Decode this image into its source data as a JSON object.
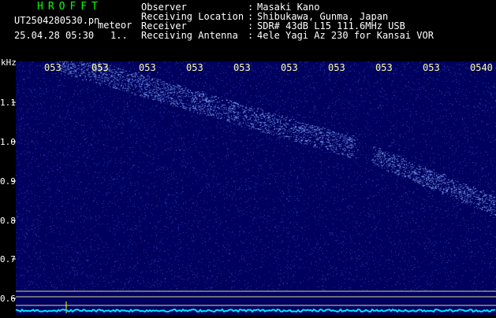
{
  "header": {
    "app_title": "HROFFT",
    "file_name": "UT2504280530.pn",
    "meteor_label": "meteor",
    "timestamp": "25.04.28 05:30",
    "count": "1.."
  },
  "info": [
    {
      "key": "Observer",
      "sep": ":",
      "value": "Masaki Kano"
    },
    {
      "key": "Receiving Location",
      "sep": ":",
      "value": "Shibukawa, Gunma, Japan"
    },
    {
      "key": "Receiver",
      "sep": ":",
      "value": "SDR# 43dB L15 111.6MHz USB"
    },
    {
      "key": "Receiving Antenna",
      "sep": ":",
      "value": "4ele Yagi Az 230 for Kansai VOR"
    }
  ],
  "plot": {
    "y_unit": "kHz",
    "y_ticks": [
      "1.1",
      "1.0",
      "0.9",
      "0.8",
      "0.7",
      "0.6"
    ],
    "x_ticks": [
      "053",
      "053",
      "053",
      "053",
      "053",
      "053",
      "053",
      "053",
      "053",
      "0540"
    ],
    "colors": {
      "background": "#00005e",
      "echo": "#7fa6ff",
      "marker_line": "#d8d8a0",
      "spectrum": "#00e5ff",
      "cursor": "#ffff00"
    }
  }
}
